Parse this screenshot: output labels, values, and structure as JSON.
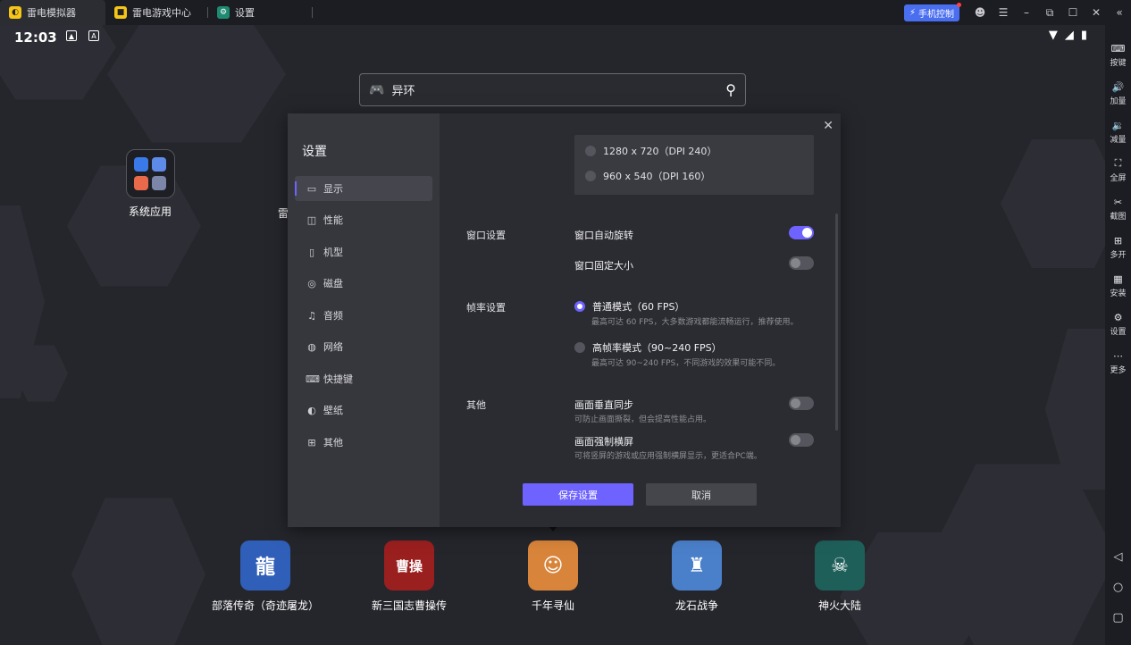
{
  "titlebar": {
    "tabs": [
      {
        "label": "雷电模拟器",
        "active": true
      },
      {
        "label": "雷电游戏中心",
        "active": false
      },
      {
        "label": "设置",
        "active": false
      }
    ],
    "phone_control": "手机控制"
  },
  "status_bar": {
    "time": "12:03"
  },
  "search": {
    "placeholder": "异环"
  },
  "desktop": {
    "system_apps": "系统应用",
    "partial_app": "雷"
  },
  "games": [
    {
      "name": "部落传奇（奇迹屠龙）",
      "glyph": "龍",
      "color": "#2f5fb8"
    },
    {
      "name": "新三国志曹操传",
      "glyph": "曹操",
      "color": "#9a1f1f"
    },
    {
      "name": "千年寻仙",
      "glyph": "☺",
      "color": "#d8843a"
    },
    {
      "name": "龙石战争",
      "glyph": "♜",
      "color": "#4a7fc9"
    },
    {
      "name": "神火大陆",
      "glyph": "☠",
      "color": "#1f5f5a"
    }
  ],
  "sidebar": {
    "items": [
      {
        "label": "按键",
        "icon": "keyboard-icon",
        "glyph": "⌨"
      },
      {
        "label": "加量",
        "icon": "volume-up-icon",
        "glyph": "🔊"
      },
      {
        "label": "减量",
        "icon": "volume-down-icon",
        "glyph": "🔉"
      },
      {
        "label": "全屏",
        "icon": "fullscreen-icon",
        "glyph": "⛶"
      },
      {
        "label": "截图",
        "icon": "scissors-icon",
        "glyph": "✂"
      },
      {
        "label": "多开",
        "icon": "multi-instance-icon",
        "glyph": "⊞"
      },
      {
        "label": "安装",
        "icon": "install-icon",
        "glyph": "▦"
      },
      {
        "label": "设置",
        "icon": "gear-icon",
        "glyph": "⚙"
      },
      {
        "label": "更多",
        "icon": "more-icon",
        "glyph": "⋯"
      }
    ],
    "nav": [
      "◁",
      "○",
      "▢"
    ]
  },
  "settings": {
    "title": "设置",
    "nav_items": [
      {
        "label": "显示",
        "glyph": "▭",
        "active": true
      },
      {
        "label": "性能",
        "glyph": "◫"
      },
      {
        "label": "机型",
        "glyph": "▯"
      },
      {
        "label": "磁盘",
        "glyph": "◎"
      },
      {
        "label": "音频",
        "glyph": "♫"
      },
      {
        "label": "网络",
        "glyph": "◍"
      },
      {
        "label": "快捷键",
        "glyph": "⌨"
      },
      {
        "label": "壁纸",
        "glyph": "◐"
      },
      {
        "label": "其他",
        "glyph": "⊞"
      }
    ],
    "resolutions": [
      "1280 x 720（DPI 240）",
      "960 x 540（DPI 160）"
    ],
    "window": {
      "section": "窗口设置",
      "auto_rotate": "窗口自动旋转",
      "auto_rotate_on": true,
      "fixed_size": "窗口固定大小",
      "fixed_size_on": false
    },
    "framerate": {
      "section": "帧率设置",
      "normal": "普通模式（60 FPS）",
      "normal_desc": "最高可达 60 FPS，大多数游戏都能流畅运行，推荐使用。",
      "high": "高帧率模式（90~240 FPS）",
      "high_desc": "最高可达 90~240 FPS，不同游戏的效果可能不同。",
      "selected": "normal"
    },
    "other": {
      "section": "其他",
      "vsync": "画面垂直同步",
      "vsync_desc": "可防止画面撕裂，但会提高性能占用。",
      "vsync_on": false,
      "force_landscape": "画面强制横屏",
      "force_landscape_desc": "可将竖屏的游戏或应用强制横屏显示，更适合PC端。",
      "force_landscape_on": false
    },
    "save_label": "保存设置",
    "cancel_label": "取消"
  },
  "colors": {
    "accent": "#6e63ff",
    "phone_control": "#4a6ef0"
  }
}
